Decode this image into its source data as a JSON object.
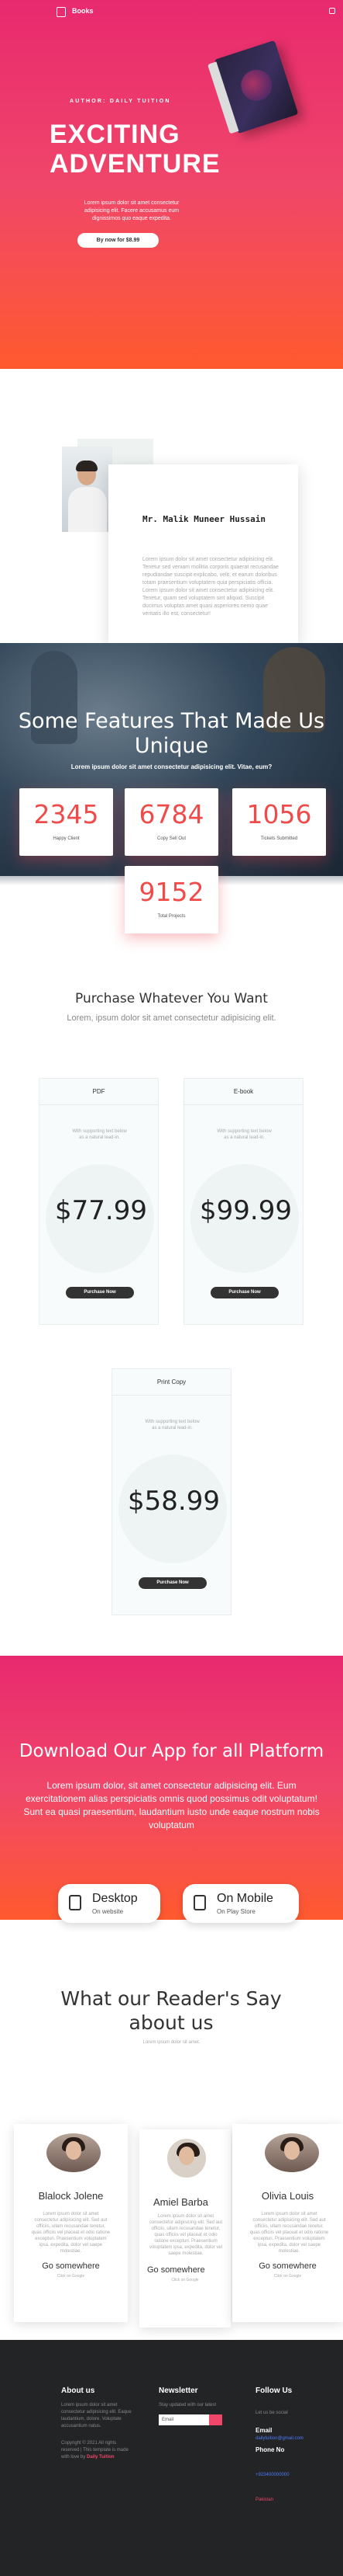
{
  "nav": {
    "brand": "Books"
  },
  "hero": {
    "author_line": "AUTHOR: DAILY TUITION",
    "title": "EXCITING ADVENTURE",
    "desc": "Lorem ipsum dolor sit amet consectetur adipisicing elit. Facere accusamus eum dignissimos quo eaque expedita.",
    "button": "By now for $8.99"
  },
  "author": {
    "name": "Mr. Malik Muneer Hussain",
    "bio": "Lorem ipsum dolor sit amet consectetur adipisicing elit. Tenetur sed veniam mollitia corporis quaerat recusandae repudiandae suscipit explicabo, velit, et earum doloribus totam praesentium voluptatem quia perspiciatis officia. Lorem ipsum dolor sit amet consectetur adipisicing elit. Tenetur, quam sed voluptatem sint aliquid. Suscipit ducimus voluptas amet quasi asperiores nemo quae veritatis illo est, consectetur!"
  },
  "features": {
    "title": "Some Features That Made Us Unique",
    "sub": "Lorem ipsum dolor sit amet consectetur adipisicing elit. Vitae, eum?",
    "counters": [
      {
        "value": "2345",
        "label": "Happy Client"
      },
      {
        "value": "6784",
        "label": "Copy Sell Out"
      },
      {
        "value": "1056",
        "label": "Tickets Submitted"
      },
      {
        "value": "9152",
        "label": "Total Projects"
      }
    ]
  },
  "purchase": {
    "title": "Purchase Whatever You Want",
    "sub": "Lorem, ipsum dolor sit amet consectetur adipisicing elit.",
    "plans": [
      {
        "name": "PDF",
        "desc": "With supporting text below as a natural lead-in.",
        "price": "$77.99",
        "button": "Purchase Now"
      },
      {
        "name": "E-book",
        "desc": "With supporting text below as a natural lead-in.",
        "price": "$99.99",
        "button": "Purchase Now"
      },
      {
        "name": "Print Copy",
        "desc": "With supporting text below as a natural lead-in.",
        "price": "$58.99",
        "button": "Purchase Now"
      }
    ]
  },
  "app": {
    "title": "Download Our App for all Platform",
    "text": "Lorem ipsum dolor, sit amet consectetur adipisicing elit. Eum exercitationem alias perspiciatis omnis quod possimus odit voluptatum! Sunt ea quasi praesentium, laudantium iusto unde eaque nostrum nobis voluptatum",
    "buttons": [
      {
        "title": "Desktop",
        "sub": "On website"
      },
      {
        "title": "On Mobile",
        "sub": "On Play Store"
      }
    ]
  },
  "readers": {
    "title": "What our Reader's Say about us",
    "sub": "Lorem ipsum dolor sit amet.",
    "cards": [
      {
        "name": "Blalock Jolene",
        "text": "Lorem ipsum dolor sit amet consectetur adipisicing elit. Sed aut officiis, ullam recusandae tenetur, quas officiis vel placeat et odio ratione excepturi. Praesentium voluptatem ipsa, expedita, dolor vel saepe molestiae.",
        "link": "Go somewhere",
        "small": "Click on Google"
      },
      {
        "name": "Amiel Barba",
        "text": "Lorem ipsum dolor sit amet consectetur adipisicing elit. Sed aut officiis, ullam recusandae tenetur, quas officiis vel placeat et odio ratione excepturi. Praesentium voluptatem ipsa, expedita, dolor vel saepe molestiae.",
        "link": "Go somewhere",
        "small": "Click on Google"
      },
      {
        "name": "Olivia Louis",
        "text": "Lorem ipsum dolor sit amet consectetur adipisicing elit. Sed aut officiis, ullam recusandae tenetur, quas officiis vel placeat et odio ratione excepturi. Praesentium voluptatem ipsa, expedita, dolor vel saepe molestiae.",
        "link": "Go somewhere",
        "small": "Click on Google"
      }
    ]
  },
  "footer": {
    "about_title": "About us",
    "about_text": "Lorem ipsum dolor sit amet consectetur adipisicing elit. Eaque laudantium, dolore. Voluptate accusantium natus.",
    "copyright_pre": "Copyright © 2021 All rights reserved | This template is made with love by",
    "copyright_brand": "Daily Tuition",
    "newsletter_title": "Newsletter",
    "newsletter_text": "Stay updated with our latest",
    "newsletter_placeholder": "Email",
    "follow_title": "Follow Us",
    "follow_text": "Let us be social",
    "email_label": "Email",
    "email_value": "dailytuition@gmail.com",
    "phone_label": "Phone No",
    "phone_value": "+923400000000",
    "location": "Pakistan"
  },
  "colors": {
    "accent": "#f0466a",
    "gradient_start": "#e8296e",
    "gradient_end": "#ff5a2e",
    "footer_bg": "#222426"
  }
}
